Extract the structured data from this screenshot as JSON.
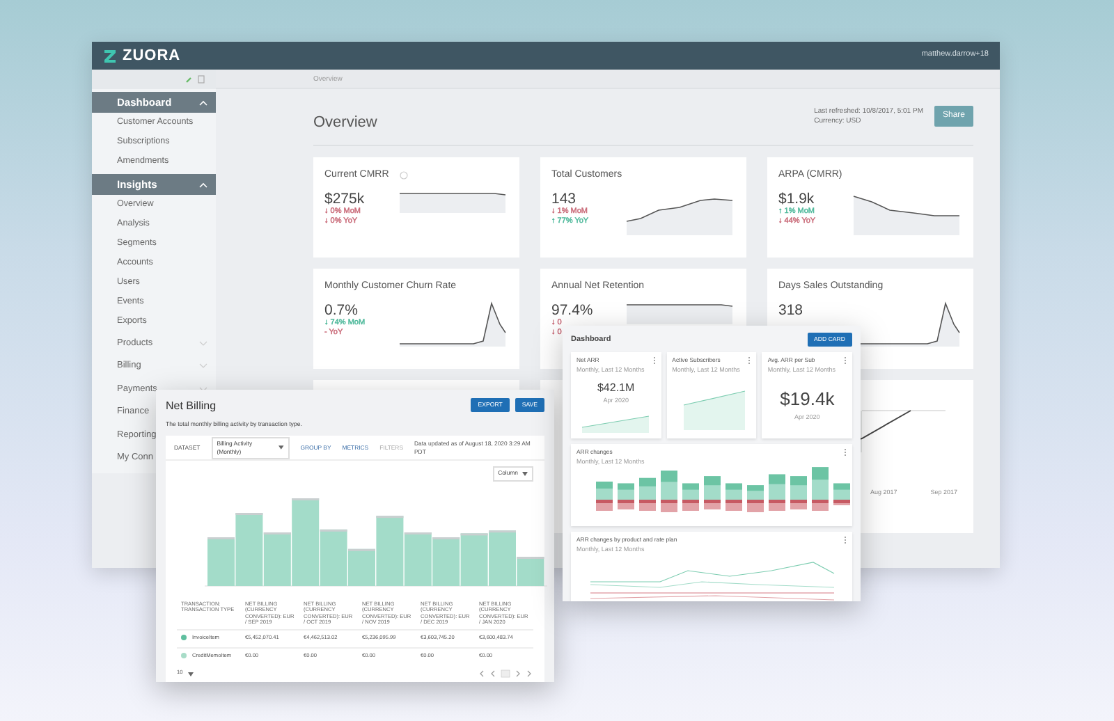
{
  "main_window": {
    "logo": "ZUORA",
    "user": "matthew.darrow+18",
    "breadcrumb": "Overview",
    "sidebar": [
      {
        "label": "Dashboard",
        "expanded": true,
        "items": [
          "Customer Accounts",
          "Subscriptions",
          "Amendments"
        ]
      },
      {
        "label": "Insights",
        "expanded": true,
        "items": [
          "Overview",
          "Analysis",
          "Segments",
          "Accounts",
          "Users",
          "Events",
          "Exports"
        ]
      },
      {
        "label": "Products",
        "expanded": false
      },
      {
        "label": "Billing",
        "expanded": false
      },
      {
        "label": "Payments",
        "expanded": false
      },
      {
        "label": "Finance",
        "expanded": false
      },
      {
        "label": "Reporting",
        "expanded": false
      },
      {
        "label": "My Conn",
        "expanded": false
      }
    ],
    "page_title": "Overview",
    "last_refreshed": "Last refreshed: 10/8/2017, 5:01 PM",
    "currency": "Currency: USD",
    "share_button": "Share",
    "cards": [
      {
        "title": "Current CMRR",
        "info": true,
        "value": "$275k",
        "kind": "flat",
        "changes": [
          {
            "text": "↓ 0% MoM",
            "color": "#c96a78"
          },
          {
            "text": "↓ 0% YoY",
            "color": "#c96a78"
          }
        ]
      },
      {
        "title": "Total Customers",
        "info": false,
        "value": "143",
        "kind": "rise",
        "changes": [
          {
            "text": "↓ 1% MoM",
            "color": "#c96a78"
          },
          {
            "text": "↑ 77% YoY",
            "color": "#4db89a"
          }
        ]
      },
      {
        "title": "ARPA (CMRR)",
        "info": false,
        "value": "$1.9k",
        "kind": "fall",
        "changes": [
          {
            "text": "↑ 1% MoM",
            "color": "#4db89a"
          },
          {
            "text": "↓ 44% YoY",
            "color": "#c96a78"
          }
        ]
      },
      {
        "title": "Monthly Customer Churn Rate",
        "info": false,
        "value": "0.7%",
        "kind": "spike",
        "changes": [
          {
            "text": "↓ 74% MoM",
            "color": "#4db89a"
          },
          {
            "text": "- YoY",
            "color": "#c96a78"
          }
        ]
      },
      {
        "title": "Annual Net Retention",
        "info": false,
        "value": "97.4%",
        "kind": "flat",
        "changes": [
          {
            "text": "↓ 0",
            "color": "#c96a78"
          },
          {
            "text": "↓ 0",
            "color": "#c96a78"
          }
        ]
      },
      {
        "title": "Days Sales Outstanding",
        "info": false,
        "value": "318",
        "kind": "spike"
      }
    ],
    "bottom_card": {
      "x_labels": [
        "Aug 2017",
        "Sep 2017"
      ]
    }
  },
  "net_billing": {
    "title": "Net Billing",
    "description": "The total monthly billing activity by transaction type.",
    "buttons": [
      "EXPORT",
      "SAVE"
    ],
    "dataset_label": "DATASET",
    "dataset": "Billing Activity (Monthly)",
    "actions": [
      "GROUP BY",
      "METRICS",
      "FILTERS"
    ],
    "updated": "Data updated as of August 18, 2020 3:29 AM PDT",
    "chart_type": "Column",
    "columns": [
      "TRANSACTION: TRANSACTION TYPE",
      "NET BILLING (CURRENCY CONVERTED): EUR / SEP 2019",
      "NET BILLING (CURRENCY CONVERTED): EUR / OCT 2019",
      "NET BILLING (CURRENCY CONVERTED): EUR / NOV 2019",
      "NET BILLING (CURRENCY CONVERTED): EUR / DEC 2019",
      "NET BILLING (CURRENCY CONVERTED): EUR / JAN 2020"
    ],
    "rows": [
      {
        "color": "#5fbf9f",
        "cells": [
          "InvoiceItem",
          "€5,452,070.41",
          "€4,462,513.02",
          "€5,236,095.99",
          "€3,603,745.20",
          "€3,600,483.74"
        ]
      },
      {
        "color": "#a8dcc8",
        "cells": [
          "CreditMemoItem",
          "€0.00",
          "€0.00",
          "€0.00",
          "€0.00",
          "€0.00"
        ]
      }
    ],
    "page_size": "10"
  },
  "dashboard": {
    "title": "Dashboard",
    "add_button": "ADD CARD",
    "tiles": [
      {
        "title": "Net ARR",
        "subtitle": "Monthly, Last 12 Months",
        "value": "$42.1M",
        "date": "Apr 2020"
      },
      {
        "title": "Active Subscribers",
        "subtitle": "Monthly, Last 12 Months"
      },
      {
        "title": "Avg. ARR per Sub",
        "subtitle": "Monthly, Last 12 Months",
        "value": "$19.4k",
        "date": "Apr 2020"
      }
    ],
    "panels": [
      {
        "title": "ARR changes",
        "subtitle": "Monthly, Last 12 Months",
        "kind": "bars"
      },
      {
        "title": "ARR changes by product and rate plan",
        "subtitle": "Monthly, Last 12 Months",
        "kind": "lines"
      }
    ]
  }
}
